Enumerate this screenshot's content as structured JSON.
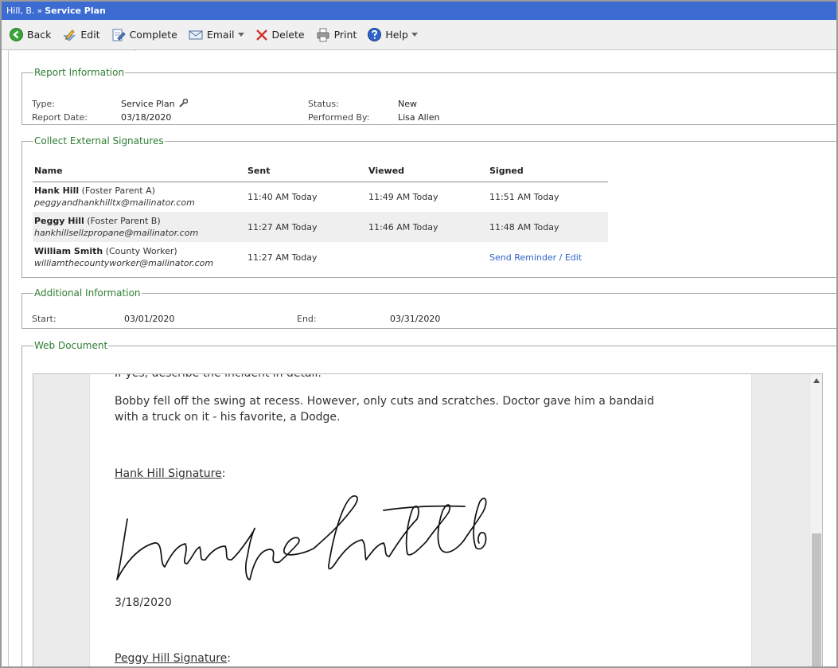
{
  "titlebar": {
    "client": "Hill, B.",
    "separator": "»",
    "title": "Service Plan"
  },
  "toolbar": {
    "back": "Back",
    "edit": "Edit",
    "complete": "Complete",
    "email": "Email",
    "delete": "Delete",
    "print": "Print",
    "help": "Help"
  },
  "report_info": {
    "legend": "Report Information",
    "type_label": "Type:",
    "type_value": "Service Plan",
    "date_label": "Report Date:",
    "date_value": "03/18/2020",
    "status_label": "Status:",
    "status_value": "New",
    "performed_label": "Performed By:",
    "performed_value": "Lisa Allen"
  },
  "signatures": {
    "legend": "Collect External Signatures",
    "headers": {
      "name": "Name",
      "sent": "Sent",
      "viewed": "Viewed",
      "signed": "Signed"
    },
    "rows": [
      {
        "name": "Hank Hill",
        "role": "(Foster Parent A)",
        "email": "peggyandhankhilltx@mailinator.com",
        "sent": "11:40 AM Today",
        "viewed": "11:49 AM Today",
        "signed": "11:51 AM Today"
      },
      {
        "name": "Peggy Hill",
        "role": "(Foster Parent B)",
        "email": "hankhillsellzpropane@mailinator.com",
        "sent": "11:27 AM Today",
        "viewed": "11:46 AM Today",
        "signed": "11:48 AM Today"
      },
      {
        "name": "William Smith",
        "role": "(County Worker)",
        "email": "williamthecountyworker@mailinator.com",
        "sent": "11:27 AM Today",
        "viewed": "",
        "signed": "Send Reminder / Edit"
      }
    ]
  },
  "additional": {
    "legend": "Additional Information",
    "start_label": "Start:",
    "start_value": "03/01/2020",
    "end_label": "End:",
    "end_value": "03/31/2020"
  },
  "web_document": {
    "legend": "Web Document",
    "partial_line": "If yes, describe the incident in detail.",
    "incident_line1": "Bobby fell off the swing at recess. However, only cuts and scratches. Doctor gave him a bandaid",
    "incident_line2": "with a truck on it - his favorite, a Dodge.",
    "hank_sig_label": "Hank Hill Signature",
    "colon": ":",
    "signature_script": "hankhill",
    "hank_sig_date": "3/18/2020",
    "peggy_sig_label": "Peggy Hill Signature"
  },
  "icons": {
    "back": "back-arrow-icon",
    "edit": "pencil-icon",
    "complete": "complete-icon",
    "email": "envelope-icon",
    "delete": "delete-x-icon",
    "print": "printer-icon",
    "help": "help-icon",
    "type_tool": "wrench-icon"
  },
  "colors": {
    "titlebar": "#3c6cd1",
    "legend": "#2e7d32",
    "link": "#2f62c9",
    "delete": "#d32f2f"
  }
}
